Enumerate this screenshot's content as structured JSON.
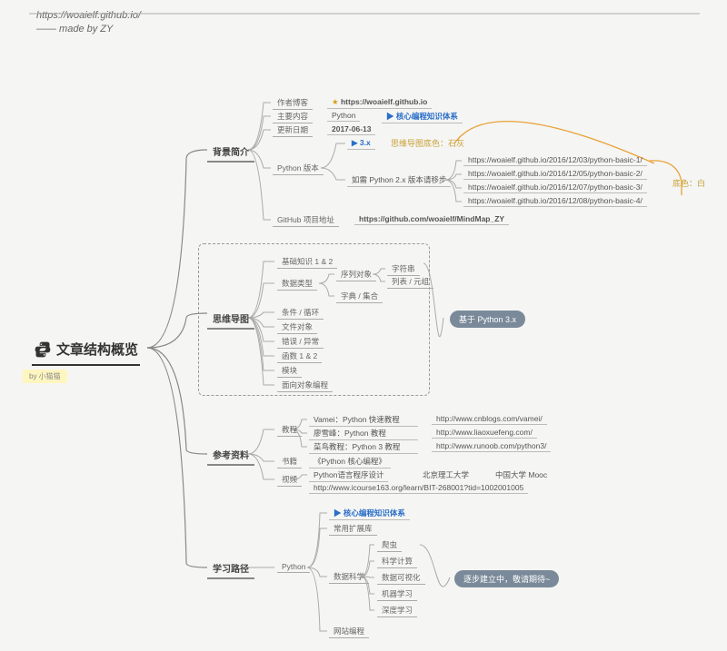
{
  "header": {
    "url": "https://woaielf.github.io/",
    "credit": "—— made by ZY"
  },
  "credit_label": "by 小猫猫",
  "root_title": "文章结构概览",
  "sections": {
    "background": {
      "title": "背景简介",
      "author_blog": {
        "label": "作者博客",
        "value": "https://woaielf.github.io"
      },
      "main_content": {
        "label": "主要内容",
        "value1": "Python",
        "value2": "核心编程知识体系"
      },
      "update_date": {
        "label": "更新日期",
        "value": "2017-06-13"
      },
      "python_version": {
        "label": "Python 版本",
        "v3": "3.x",
        "note": "如需 Python 2.x 版本请移步",
        "annotation": "思维导图底色：石灰"
      },
      "v2_links": [
        "https://woaielf.github.io/2016/12/03/python-basic-1/",
        "https://woaielf.github.io/2016/12/05/python-basic-2/",
        "https://woaielf.github.io/2016/12/07/python-basic-3/",
        "https://woaielf.github.io/2016/12/08/python-basic-4/"
      ],
      "github": {
        "label": "GitHub 项目地址",
        "value": "https://github.com/woaielf/MindMap_ZY"
      },
      "annotation_right": "底色：白"
    },
    "mindmap": {
      "title": "思维导图",
      "items": {
        "basic": "基础知识 1 & 2",
        "datatype": {
          "label": "数据类型",
          "seq": {
            "label": "序列对象",
            "str": "字符串",
            "list": "列表 / 元组"
          },
          "dict": "字典 / 集合"
        },
        "cond": "条件 / 循环",
        "file": "文件对象",
        "err": "错误 / 异常",
        "func": "函数 1 & 2",
        "mod": "模块",
        "oop": "面向对象编程"
      },
      "badge": "基于 Python 3.x"
    },
    "references": {
      "title": "参考资料",
      "tutorial": {
        "label": "教程",
        "rows": [
          {
            "name": "Vamei：Python 快速教程",
            "url": "http://www.cnblogs.com/vamei/"
          },
          {
            "name": "廖雪峰：Python 教程",
            "url": "http://www.liaoxuefeng.com/"
          },
          {
            "name": "菜鸟教程：Python 3 教程",
            "url": "http://www.runoob.com/python3/"
          }
        ]
      },
      "book": {
        "label": "书籍",
        "value": "《Python 核心编程》"
      },
      "video": {
        "label": "视频",
        "value": "Python语言程序设计",
        "u1": "北京理工大学",
        "u2": "中国大学 Mooc",
        "url": "http://www.icourse163.org/learn/BIT-268001?tid=1002001005"
      }
    },
    "learning": {
      "title": "学习路径",
      "python": "Python",
      "core": "核心编程知识体系",
      "ext": "常用扩展库",
      "ds": {
        "label": "数据科学",
        "items": [
          "爬虫",
          "科学计算",
          "数据可视化",
          "机器学习",
          "深度学习"
        ]
      },
      "web": "网站编程",
      "badge": "逐步建立中，敬请期待~"
    }
  }
}
